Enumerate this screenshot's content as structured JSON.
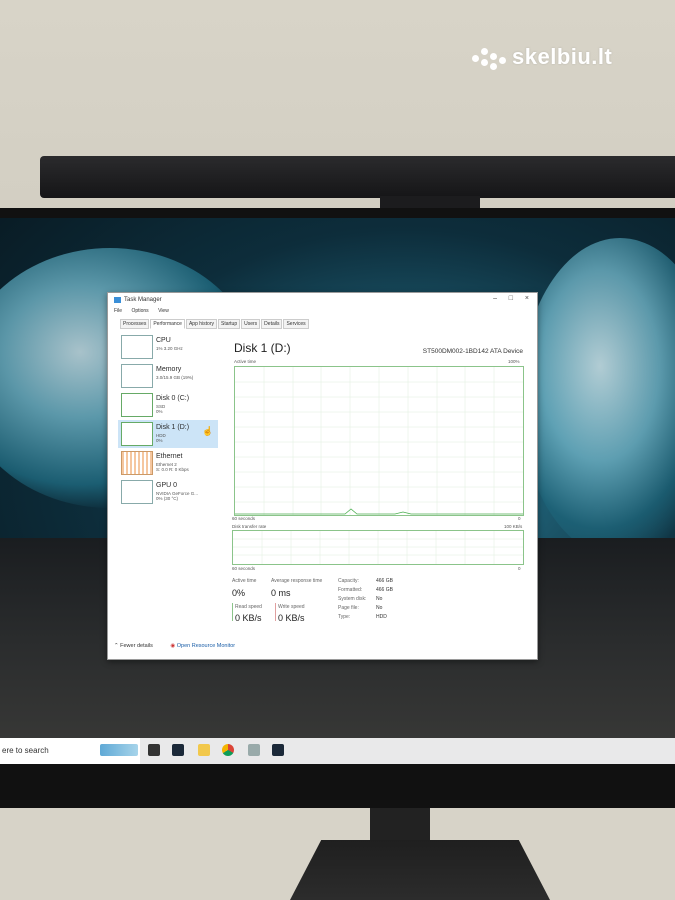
{
  "watermark": "skelbiu.lt",
  "taskmanager": {
    "title": "Task Manager",
    "menu": [
      "File",
      "Options",
      "View"
    ],
    "tabs": [
      "Processes",
      "Performance",
      "App history",
      "Startup",
      "Users",
      "Details",
      "Services"
    ],
    "active_tab": "Performance",
    "sidebar": [
      {
        "name": "CPU",
        "sub": "1% 3.20 GHz"
      },
      {
        "name": "Memory",
        "sub": "3.0/15.9 GB (19%)"
      },
      {
        "name": "Disk 0 (C:)",
        "sub": "SSD\n0%"
      },
      {
        "name": "Disk 1 (D:)",
        "sub": "HDD\n0%"
      },
      {
        "name": "Ethernet",
        "sub": "Ethernet 2\nS: 0.0 R: 0 Kbps"
      },
      {
        "name": "GPU 0",
        "sub": "NVIDIA GeForce G...\n0% (30 °C)"
      }
    ],
    "selected": "Disk 1 (D:)",
    "main": {
      "title": "Disk 1 (D:)",
      "device": "ST500DM002-1BD142 ATA Device",
      "active_time_label": "Active time",
      "active_time_max": "100%",
      "graph_time_left": "60 seconds",
      "graph_time_right": "0",
      "transfer_label": "Disk transfer rate",
      "transfer_max": "100 KB/s",
      "transfer_time_left": "60 seconds",
      "transfer_time_right": "0",
      "stats": {
        "active_time_label": "Active time",
        "active_time": "0%",
        "avg_resp_label": "Average response time",
        "avg_resp": "0 ms",
        "read_label": "Read speed",
        "read": "0 KB/s",
        "write_label": "Write speed",
        "write": "0 KB/s"
      },
      "props": [
        {
          "k": "Capacity:",
          "v": "466 GB"
        },
        {
          "k": "Formatted:",
          "v": "466 GB"
        },
        {
          "k": "System disk:",
          "v": "No"
        },
        {
          "k": "Page file:",
          "v": "No"
        },
        {
          "k": "Type:",
          "v": "HDD"
        }
      ]
    },
    "footer": {
      "fewer": "Fewer details",
      "monitor": "Open Resource Monitor"
    }
  },
  "taskbar": {
    "search": "ere to search"
  },
  "colors": {
    "graph_line": "#8bc48a",
    "selected_item": "#cce4f7"
  }
}
